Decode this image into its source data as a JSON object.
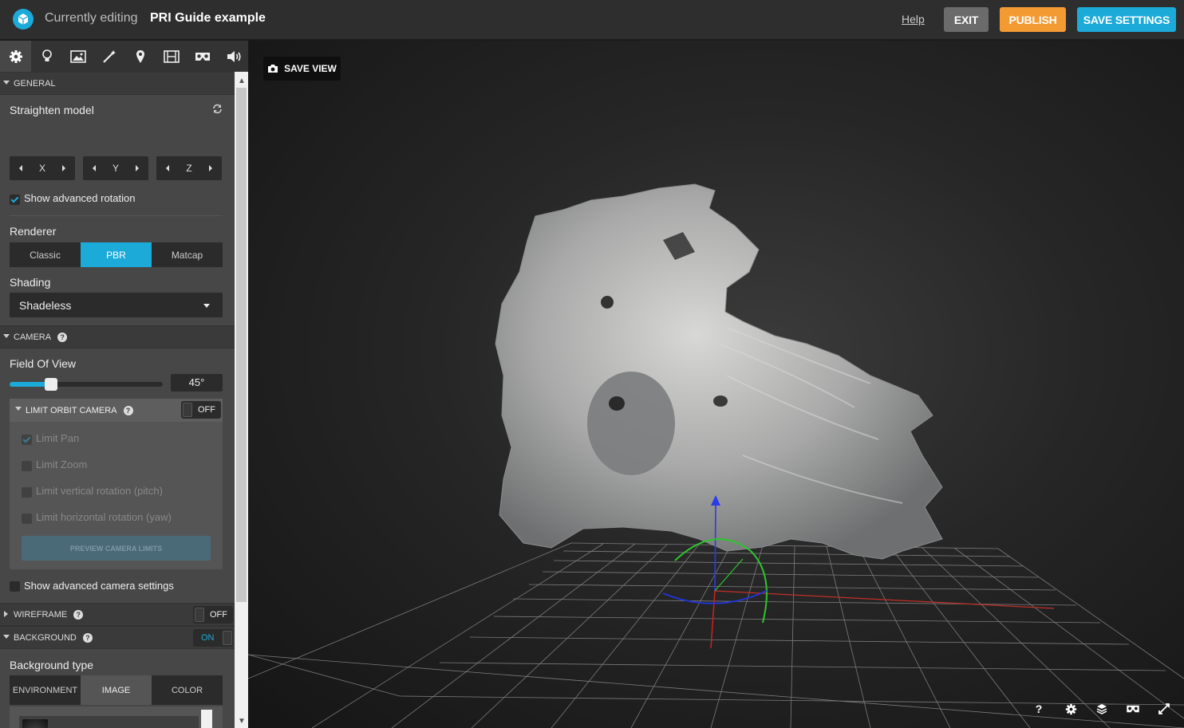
{
  "header": {
    "edit_prefix": "Currently editing",
    "model_title": "PRI Guide example",
    "help_label": "Help",
    "exit_label": "EXIT",
    "publish_label": "PUBLISH",
    "save_settings_label": "SAVE SETTINGS"
  },
  "tabs": [
    "gear-icon",
    "lightbulb-icon",
    "image-icon",
    "wand-icon",
    "pin-icon",
    "film-icon",
    "vr-icon",
    "sound-icon"
  ],
  "general": {
    "section_label": "GENERAL",
    "straighten_label": "Straighten model",
    "axes": [
      "X",
      "Y",
      "Z"
    ],
    "advanced_rotation_label": "Show advanced rotation",
    "advanced_rotation_checked": true,
    "renderer_label": "Renderer",
    "renderer_options": [
      "Classic",
      "PBR",
      "Matcap"
    ],
    "renderer_selected": "PBR",
    "shading_label": "Shading",
    "shading_value": "Shadeless"
  },
  "camera": {
    "section_label": "CAMERA",
    "fov_label": "Field Of View",
    "fov_value": "45°",
    "fov_fraction": 0.27,
    "limit_orbit_label": "LIMIT ORBIT CAMERA",
    "limit_orbit_state": "OFF",
    "limits": [
      {
        "label": "Limit Pan",
        "checked": true
      },
      {
        "label": "Limit Zoom",
        "checked": false
      },
      {
        "label": "Limit vertical rotation (pitch)",
        "checked": false
      },
      {
        "label": "Limit horizontal rotation (yaw)",
        "checked": false
      }
    ],
    "preview_label": "PREVIEW CAMERA LIMITS",
    "advanced_camera_label": "Show advanced camera settings"
  },
  "wireframe": {
    "section_label": "WIREFRAME",
    "state": "OFF"
  },
  "background": {
    "section_label": "BACKGROUND",
    "state": "ON",
    "type_label": "Background type",
    "type_options": [
      "ENVIRONMENT",
      "IMAGE",
      "COLOR"
    ],
    "type_selected": "IMAGE",
    "image_item": "clean_dark"
  },
  "viewport": {
    "save_view_label": "SAVE VIEW",
    "icons": [
      "help-icon",
      "settings-icon",
      "layers-icon",
      "vr-icon",
      "fullscreen-icon"
    ],
    "help_glyph": "?"
  },
  "colors": {
    "accent": "#1caad9",
    "publish": "#f39a33",
    "exit": "#6b6b6b"
  }
}
